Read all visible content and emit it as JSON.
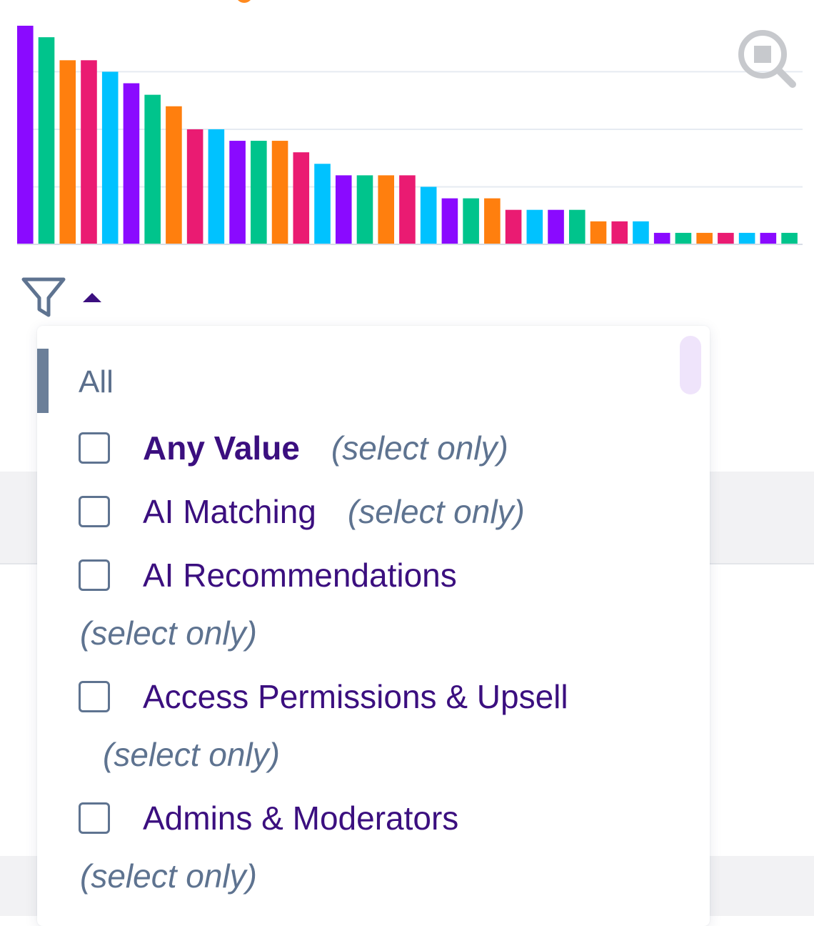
{
  "chart_data": {
    "type": "bar",
    "ylim": [
      0,
      19
    ],
    "grid": true,
    "values": [
      19,
      18,
      16,
      16,
      15,
      14,
      13,
      12,
      10,
      10,
      9,
      9,
      9,
      8,
      7,
      6,
      6,
      6,
      6,
      5,
      4,
      4,
      4,
      3,
      3,
      3,
      3,
      2,
      2,
      2,
      1,
      1,
      1,
      1,
      1,
      1,
      1
    ],
    "palette": [
      "#8a0aff",
      "#00c48c",
      "#ff7f0e",
      "#ea1b72",
      "#00c2ff"
    ],
    "color_sequence": [
      0,
      1,
      2,
      3,
      4,
      0,
      1,
      2,
      3,
      4,
      0,
      1,
      2,
      3,
      4,
      0,
      1,
      2,
      3,
      4,
      0,
      1,
      2,
      3,
      4,
      0,
      1,
      2,
      3,
      4,
      0,
      1,
      2,
      3,
      4,
      0,
      1
    ]
  },
  "toolbar": {
    "zoom_icon": "zoom-search-icon",
    "filter_icon": "funnel-filter-icon",
    "caret_icon": "caret-up-icon"
  },
  "filter_dropdown": {
    "all_label": "All",
    "options": [
      {
        "label": "Any Value",
        "suffix": "(select only)",
        "checked": false
      },
      {
        "label": "AI Matching",
        "suffix": "(select only)",
        "checked": false
      },
      {
        "label": "AI Recommendations",
        "suffix": "(select only)",
        "checked": false
      },
      {
        "label": "Access Permissions & Upsell",
        "suffix": "(select only)",
        "checked": false
      },
      {
        "label": "Admins & Moderators",
        "suffix": "(select only)",
        "checked": false
      }
    ]
  },
  "colors": {
    "accent": "#3b0f7f",
    "muted_text": "#5e7390",
    "selected_bar": "#6b7f99"
  }
}
